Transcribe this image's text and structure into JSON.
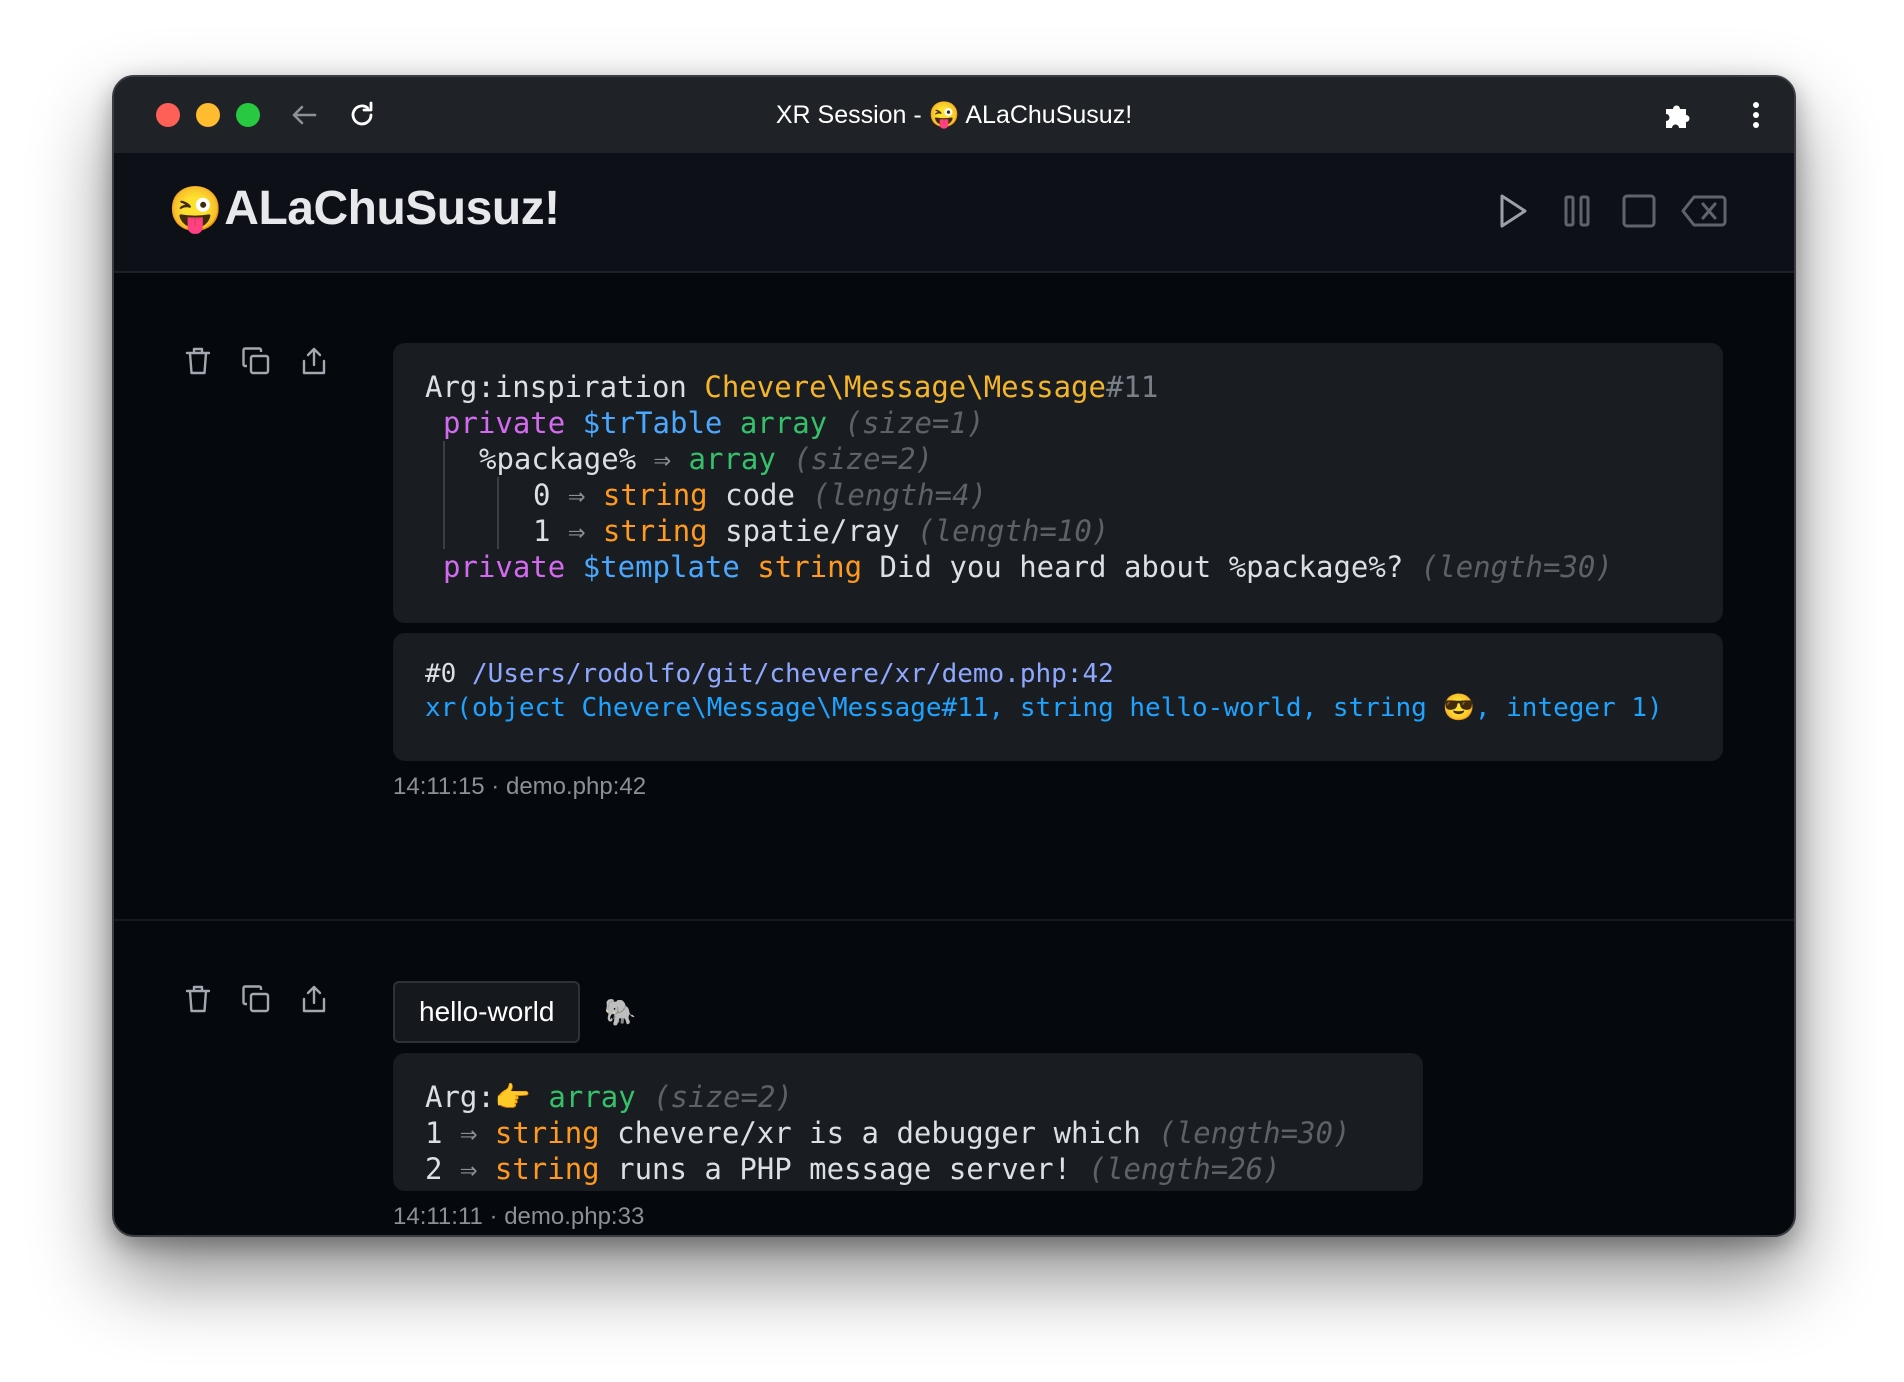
{
  "window": {
    "title": "XR Session - 😜 ALaChuSusuz!"
  },
  "app": {
    "emoji": "😜",
    "title": "ALaChuSusuz!",
    "controls": [
      "play-icon",
      "pause-icon",
      "stop-icon",
      "clear-icon"
    ]
  },
  "entries": [
    {
      "dump": {
        "l1": {
          "label": "Arg:inspiration",
          "cls": "Chevere\\Message\\Message",
          "id": "#11"
        },
        "l2": {
          "vis": "private",
          "prop": "$trTable",
          "type": "array",
          "meta": "(size=1)"
        },
        "l3": {
          "key": "%package%",
          "arrow": "⇒",
          "type": "array",
          "meta": "(size=2)"
        },
        "l4": {
          "key": "0",
          "arrow": "⇒",
          "type": "string",
          "value": "code",
          "meta": "(length=4)"
        },
        "l5": {
          "key": "1",
          "arrow": "⇒",
          "type": "string",
          "value": "spatie/ray",
          "meta": "(length=10)"
        },
        "l6": {
          "vis": "private",
          "prop": "$template",
          "type": "string",
          "value": "Did you heard about %package%?",
          "meta": "(length=30)"
        }
      },
      "trace": {
        "frame": "#0",
        "path": "/Users/rodolfo/git/chevere/xr/demo.php:42",
        "call": "xr(object Chevere\\Message\\Message#11, string hello-world, string 😎, integer 1)"
      },
      "meta": "14:11:15 · demo.php:42"
    },
    {
      "tag": "hello-world",
      "tag_emoji": "🐘",
      "dump": {
        "l1": {
          "label": "Arg:",
          "emoji": "👉",
          "type": "array",
          "meta": "(size=2)"
        },
        "l2": {
          "key": "1",
          "arrow": "⇒",
          "type": "string",
          "value": "chevere/xr is a debugger which",
          "meta": "(length=30)"
        },
        "l3": {
          "key": "2",
          "arrow": "⇒",
          "type": "string",
          "value": "runs a PHP message server!",
          "meta": "(length=26)"
        }
      },
      "meta": "14:11:11 · demo.php:33"
    }
  ],
  "colors": {
    "purple": "#d46af0",
    "blue": "#4aa8ff",
    "green": "#35c06a",
    "orange": "#ff9a1f",
    "yellow": "#f5b52a"
  }
}
